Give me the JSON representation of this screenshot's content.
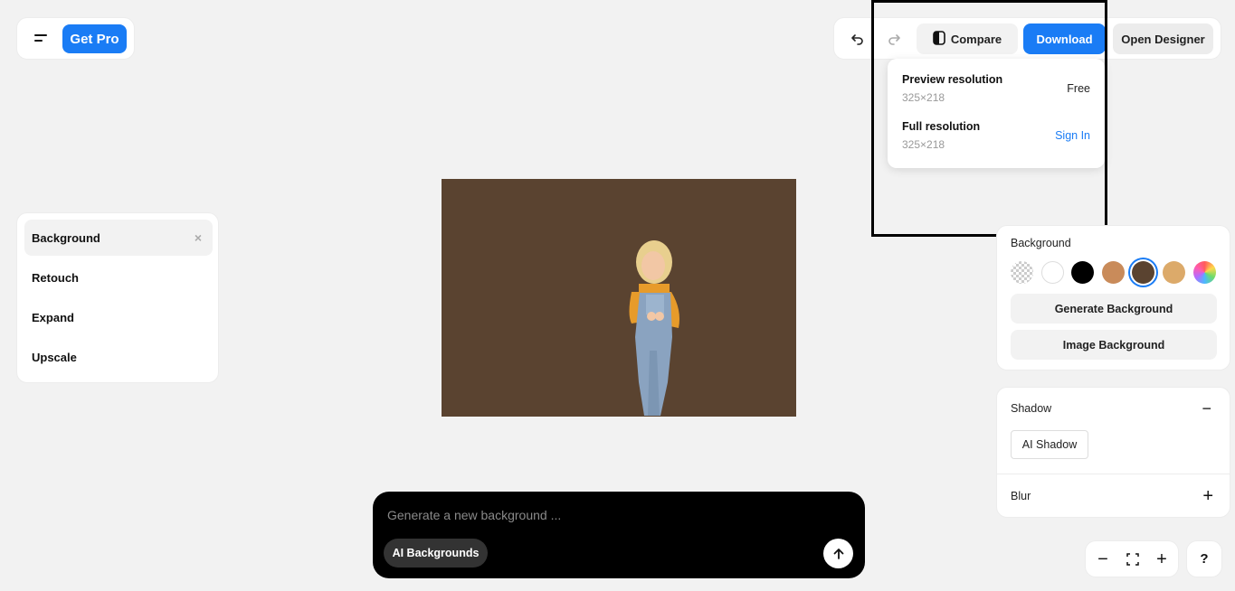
{
  "header": {
    "get_pro_label": "Get Pro"
  },
  "toolbar": {
    "compare_label": "Compare",
    "download_label": "Download",
    "open_designer_label": "Open Designer"
  },
  "download_menu": {
    "options": [
      {
        "title": "Preview resolution",
        "size": "325×218",
        "action": "Free"
      },
      {
        "title": "Full resolution",
        "size": "325×218",
        "action": "Sign In"
      }
    ]
  },
  "tools": {
    "items": [
      {
        "label": "Background",
        "active": true
      },
      {
        "label": "Retouch"
      },
      {
        "label": "Expand"
      },
      {
        "label": "Upscale"
      }
    ],
    "close_glyph": "×"
  },
  "background_panel": {
    "title": "Background",
    "swatches": [
      "transparent",
      "#ffffff",
      "#000000",
      "#c98b5a",
      "#5a4330",
      "#dcaa6a",
      "gradient"
    ],
    "selected_swatch": "#5a4330",
    "generate_label": "Generate Background",
    "image_label": "Image Background"
  },
  "shadow_panel": {
    "title": "Shadow",
    "ai_shadow_label": "AI Shadow",
    "blur_title": "Blur"
  },
  "zoom": {
    "out_glyph": "−",
    "in_glyph": "+",
    "help_glyph": "?"
  },
  "prompt": {
    "placeholder": "Generate a new background ...",
    "chip_label": "AI Backgrounds"
  },
  "colors": {
    "accent": "#1a7cf5",
    "canvas_bg": "#5a4330"
  }
}
